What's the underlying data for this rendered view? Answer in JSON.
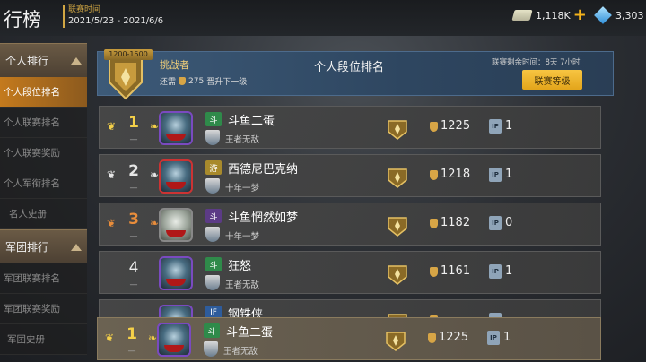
{
  "top": {
    "title": "行榜",
    "season_label": "联赛时间",
    "season_range": "2021/5/23 - 2021/6/6",
    "cash": "1,118K",
    "gems": "3,303"
  },
  "sidebar": {
    "personal_cat": "个人排行",
    "personal_items": [
      "个人段位排名",
      "个人联赛排名",
      "个人联赛奖励",
      "个人军衔排名",
      "名人史册"
    ],
    "legion_cat": "军团排行",
    "legion_items": [
      "军团联赛排名",
      "军团联赛奖励",
      "军团史册"
    ]
  },
  "header": {
    "rank_range": "1200-1500",
    "challenger": "挑战者",
    "need_prefix": "还需",
    "need_amount": "275",
    "need_suffix": "晋升下一级",
    "title": "个人段位排名",
    "time_left": "联赛剩余时间：8天 7小时",
    "league_button": "联赛等级"
  },
  "rows": [
    {
      "rank": "1",
      "dash": "—",
      "clan": "斗",
      "name": "斗鱼二蛋",
      "guild": "王者无敌",
      "score": "1225",
      "ip": "1"
    },
    {
      "rank": "2",
      "dash": "—",
      "clan": "游",
      "name": "西德尼巴克纳",
      "guild": "十年一梦",
      "score": "1218",
      "ip": "1"
    },
    {
      "rank": "3",
      "dash": "—",
      "clan": "斗",
      "name": "斗鱼惘然如梦",
      "guild": "十年一梦",
      "score": "1182",
      "ip": "0"
    },
    {
      "rank": "4",
      "dash": "—",
      "clan": "斗",
      "name": "狂怒",
      "guild": "王者无敌",
      "score": "1161",
      "ip": "1"
    },
    {
      "rank": "",
      "dash": "",
      "clan": "IF",
      "name": "钢铁侠",
      "guild": "",
      "score": "",
      "ip": ""
    }
  ],
  "my_row": {
    "rank": "1",
    "dash": "—",
    "clan": "斗",
    "name": "斗鱼二蛋",
    "guild": "王者无敌",
    "score": "1225",
    "ip": "1"
  },
  "colors": {
    "gold": "#f4d049",
    "accent_orange": "#c47a1d",
    "button_yellow": "#f7c542",
    "header_blue": "#3d5a78"
  }
}
